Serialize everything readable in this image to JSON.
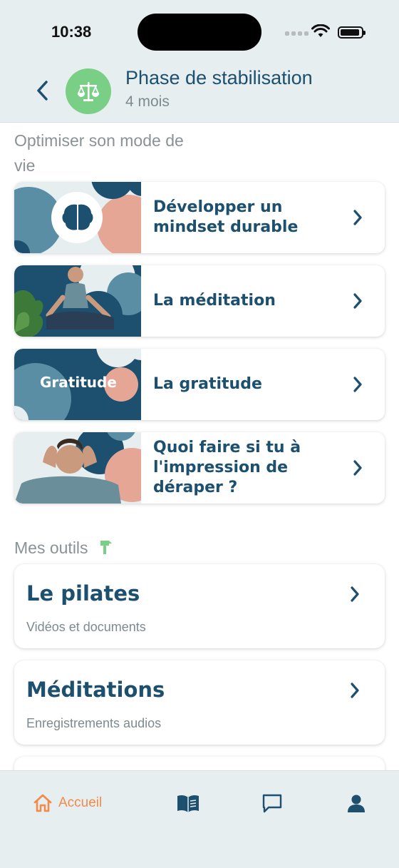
{
  "status": {
    "time": "10:38"
  },
  "header": {
    "title": "Phase de stabilisation",
    "subtitle": "4 mois",
    "badge_icon": "balance-scale-icon"
  },
  "sections": {
    "lifestyle_title": "Optimiser son mode de vie",
    "tools_title": "Mes outils"
  },
  "lifestyle_cards": [
    {
      "label": "Développer un mindset durable",
      "thumb": "brain-illustration"
    },
    {
      "label": "La méditation",
      "thumb": "meditating-man-photo"
    },
    {
      "label": "La gratitude",
      "thumb": "gratitude-illustration",
      "thumb_text": "Gratitude"
    },
    {
      "label": "Quoi faire si tu à l'impression de déraper ?",
      "thumb": "stressed-man-photo"
    }
  ],
  "tools": [
    {
      "title": "Le pilates",
      "subtitle": "Vidéos et documents"
    },
    {
      "title": "Méditations",
      "subtitle": "Enregistrements audios"
    }
  ],
  "nav": {
    "home_label": "Accueil",
    "items": [
      "home-icon",
      "book-icon",
      "chat-icon",
      "profile-icon"
    ],
    "active_color": "#f28a4a",
    "inactive_color": "#1d4f6e"
  },
  "colors": {
    "primary": "#1d4f6e",
    "accent": "#78cf85",
    "peach": "#e6a696",
    "teal": "#5a8ea5"
  }
}
